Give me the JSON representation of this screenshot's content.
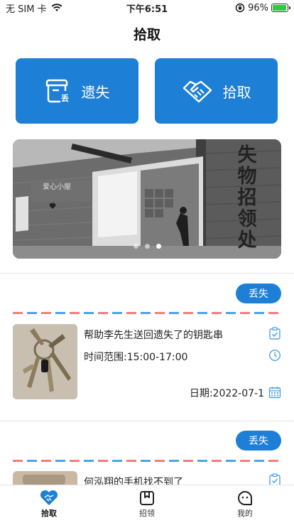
{
  "status_bar": {
    "carrier": "无 SIM 卡",
    "time": "下午6:51",
    "battery_text": "96%",
    "battery_level": 0.96,
    "icons": [
      "wifi-icon",
      "orientation-lock-icon",
      "battery-icon"
    ]
  },
  "nav": {
    "title": "拾取"
  },
  "actions": {
    "lost": {
      "label": "遗失",
      "icon": "lost-box-icon",
      "icon_badge": "丢"
    },
    "found": {
      "label": "拾取",
      "icon": "handshake-icon"
    }
  },
  "banner": {
    "sign_chars": [
      "失",
      "物",
      "招",
      "领",
      "处"
    ],
    "small_sign": "爱心小屋",
    "slide_count": 3,
    "active_slide": 3
  },
  "cards": [
    {
      "tag": "丢失",
      "title": "帮助李先生送回遗失了的钥匙串",
      "time": "时间范围:15:00-17:00",
      "date": "日期:2022-07-1",
      "thumb": "keys-photo"
    },
    {
      "tag": "丢失",
      "title": "何泓翔的手机找不到了",
      "thumb": "phone-photo"
    }
  ],
  "tabs": [
    {
      "label": "拾取",
      "icon": "handshake-heart-icon",
      "active": true
    },
    {
      "label": "招领",
      "icon": "box-icon",
      "active": false
    },
    {
      "label": "我的",
      "icon": "face-icon",
      "active": false
    }
  ],
  "colors": {
    "accent": "#1d7fd6",
    "airmail_red": "#f07e7e",
    "airmail_blue": "#4da3e6",
    "battery_green": "#2ecc40"
  }
}
